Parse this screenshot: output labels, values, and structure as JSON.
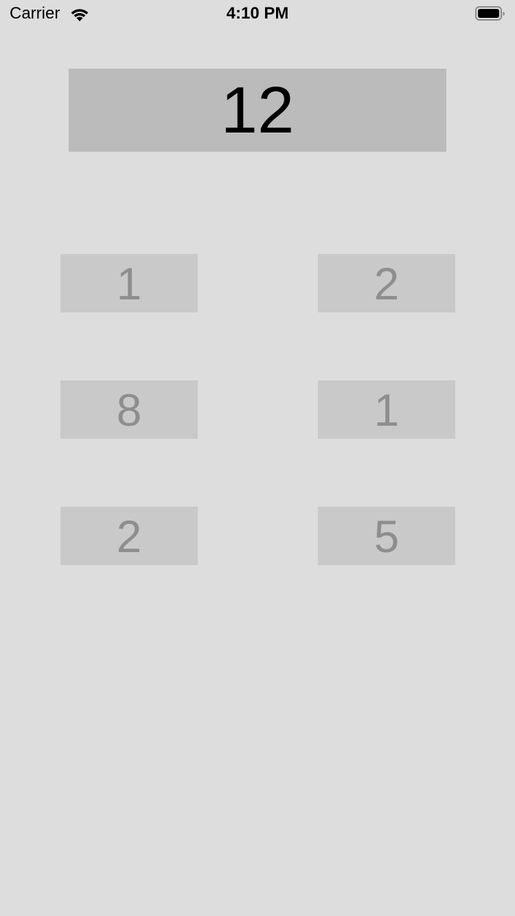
{
  "status_bar": {
    "carrier": "Carrier",
    "time": "4:10 PM",
    "wifi_icon": "wifi-icon",
    "battery_icon": "battery-full-icon"
  },
  "display": {
    "value": "12"
  },
  "tiles": [
    {
      "label": "1"
    },
    {
      "label": "2"
    },
    {
      "label": "8"
    },
    {
      "label": "1"
    },
    {
      "label": "2"
    },
    {
      "label": "5"
    }
  ],
  "colors": {
    "background": "#dddddd",
    "display_background": "#bbbbbb",
    "tile_background": "#c9c9c9",
    "tile_text": "#8e8e8e",
    "display_text": "#000000"
  }
}
